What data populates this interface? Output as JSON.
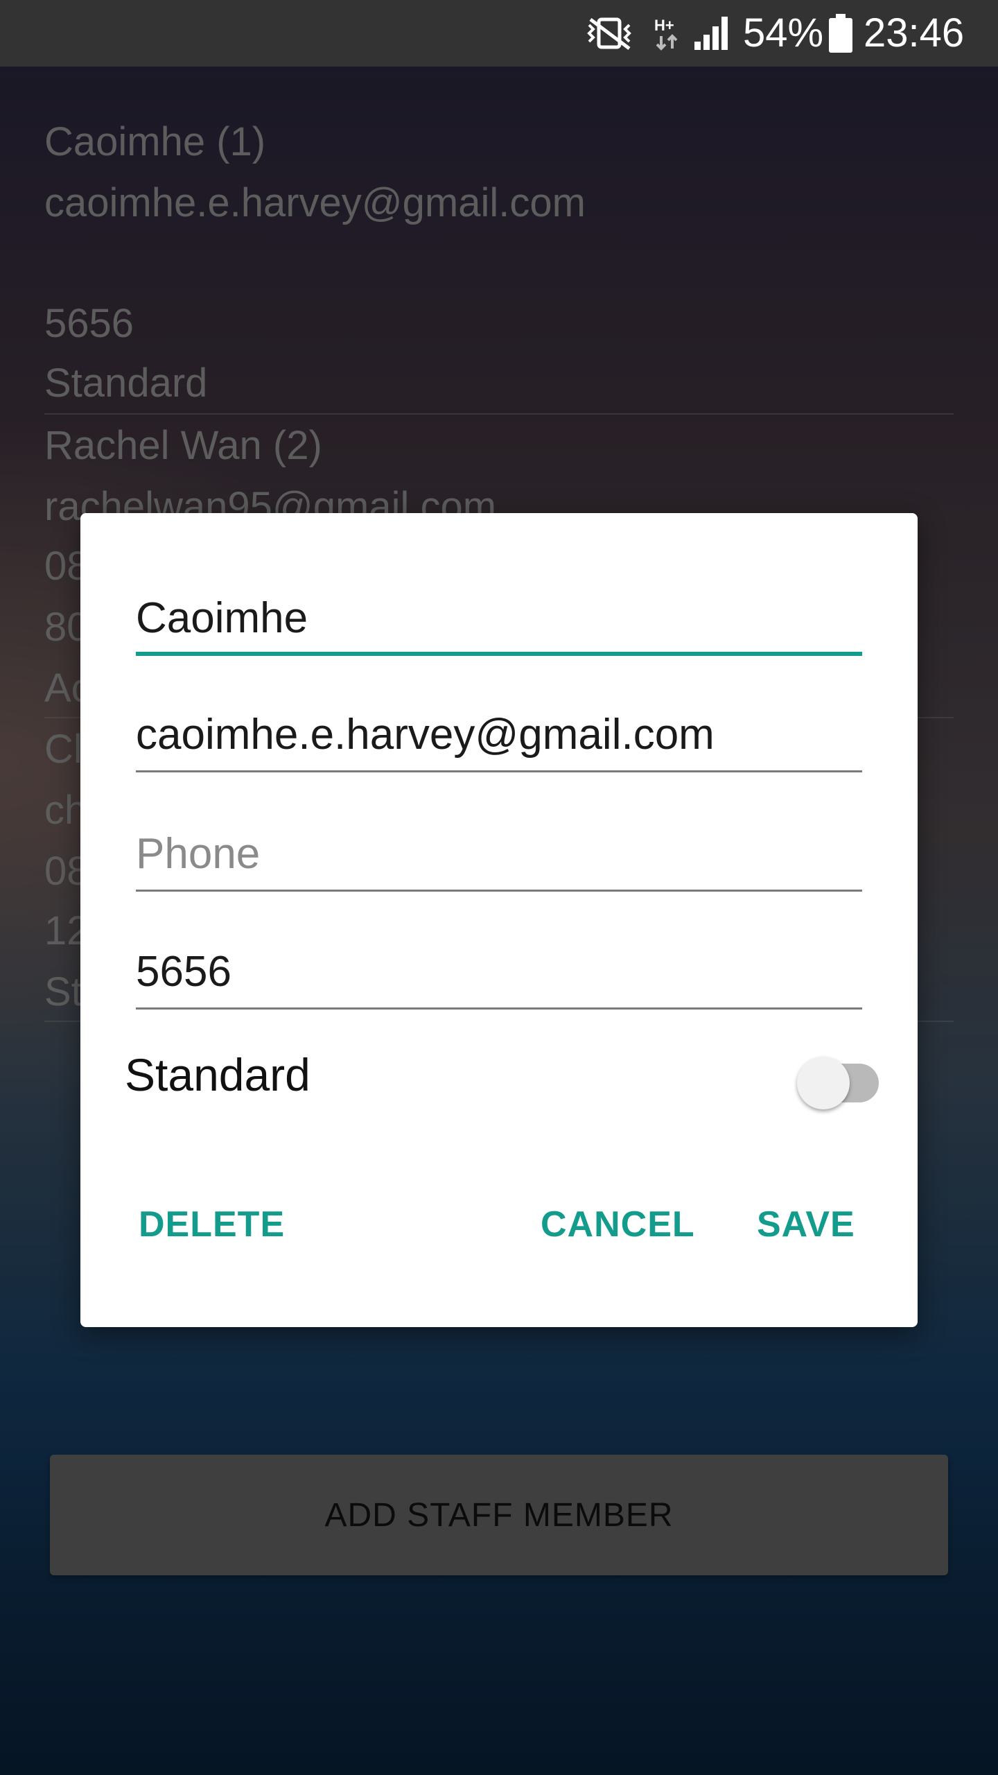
{
  "status_bar": {
    "battery_percent": "54%",
    "time": "23:46",
    "network_type": "H+",
    "icons": [
      "vibrate-mute-icon",
      "network-hplus-icon",
      "signal-icon",
      "battery-icon"
    ]
  },
  "staff_list": {
    "lines": [
      "Caoimhe (1)",
      "caoimhe.e.harvey@gmail.com",
      "5656",
      "Standard",
      "Rachel Wan (2)",
      "rachelwan95@gmail.com",
      "08",
      "80",
      "Ac",
      "Cl",
      "ch",
      "08",
      "12",
      "St"
    ]
  },
  "dialog": {
    "name_value": "Caoimhe",
    "email_value": "caoimhe.e.harvey@gmail.com",
    "phone_placeholder": "Phone",
    "pin_value": "5656",
    "toggle_label": "Standard",
    "toggle_on": false,
    "delete_label": "DELETE",
    "cancel_label": "CANCEL",
    "save_label": "SAVE"
  },
  "add_staff_label": "ADD STAFF MEMBER",
  "colors": {
    "accent": "#139b8c",
    "status_bar": "#333333",
    "dialog_bg": "#ffffff",
    "button_bg": "#5e5e5e"
  }
}
